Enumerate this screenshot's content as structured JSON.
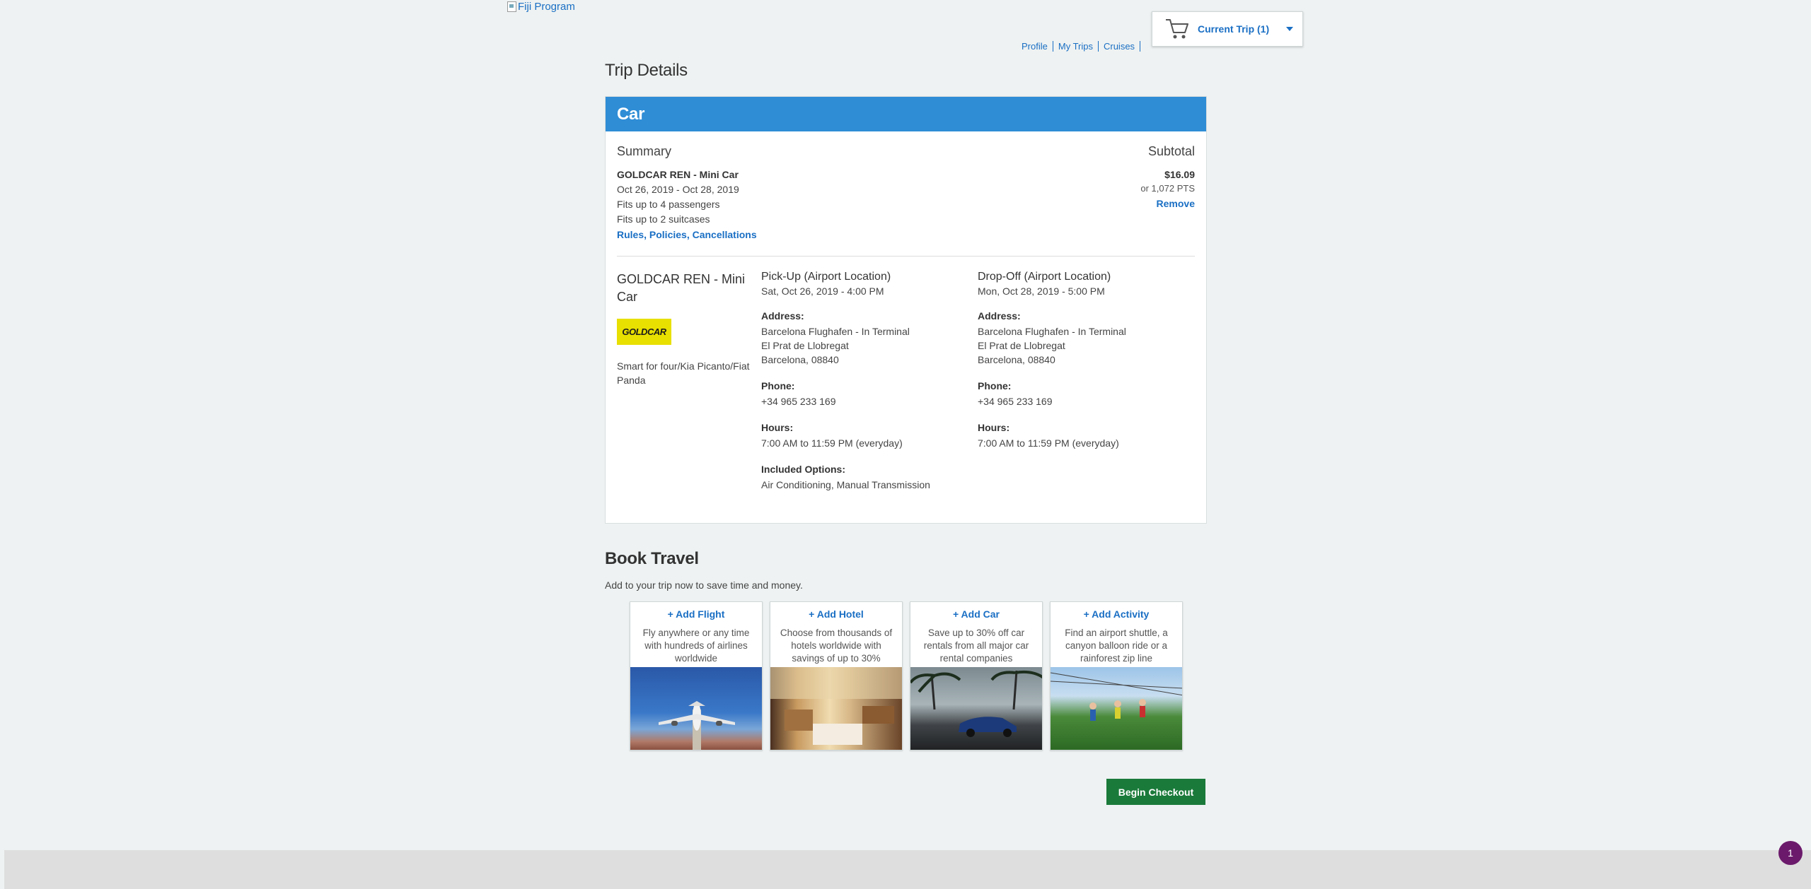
{
  "header": {
    "logo_alt": "Fiji Program",
    "nav": [
      "Profile",
      "My Trips",
      "Cruises"
    ],
    "cart_label": "Current Trip (1)"
  },
  "page_title": "Trip Details",
  "car_card": {
    "heading": "Car",
    "summary_title": "Summary",
    "subtotal_title": "Subtotal",
    "car_name": "GOLDCAR REN - Mini Car",
    "dates": "Oct 26, 2019 - Oct 28, 2019",
    "passengers": "Fits up to 4 passengers",
    "suitcases": "Fits up to 2 suitcases",
    "rules_link": "Rules, Policies, Cancellations",
    "price": "$16.09",
    "points": "or 1,072 PTS",
    "remove_label": "Remove",
    "vehicle_name": "GOLDCAR REN - Mini Car",
    "vendor_logo": "GOLDCAR",
    "vehicle_models": "Smart for four/Kia Picanto/Fiat Panda",
    "pickup": {
      "title": "Pick-Up (Airport Location)",
      "datetime": "Sat, Oct 26, 2019 - 4:00 PM",
      "address_label": "Address:",
      "address": [
        "Barcelona Flughafen - In Terminal",
        "El Prat de Llobregat",
        "Barcelona, 08840"
      ],
      "phone_label": "Phone:",
      "phone": "+34 965 233 169",
      "hours_label": "Hours:",
      "hours": "7:00 AM to 11:59 PM (everyday)",
      "options_label": "Included Options:",
      "options": "Air Conditioning, Manual Transmission"
    },
    "dropoff": {
      "title": "Drop-Off (Airport Location)",
      "datetime": "Mon, Oct 28, 2019 - 5:00 PM",
      "address_label": "Address:",
      "address": [
        "Barcelona Flughafen - In Terminal",
        "El Prat de Llobregat",
        "Barcelona, 08840"
      ],
      "phone_label": "Phone:",
      "phone": "+34 965 233 169",
      "hours_label": "Hours:",
      "hours": "7:00 AM to 11:59 PM (everyday)"
    }
  },
  "book_travel": {
    "title": "Book Travel",
    "subtitle": "Add to your trip now to save time and money.",
    "tiles": [
      {
        "title": "+ Add Flight",
        "desc": "Fly anywhere or any time with hundreds of airlines worldwide"
      },
      {
        "title": "+ Add Hotel",
        "desc": "Choose from thousands of hotels worldwide with savings of up to 30%"
      },
      {
        "title": "+ Add Car",
        "desc": "Save up to 30% off car rentals from all major car rental companies"
      },
      {
        "title": "+ Add Activity",
        "desc": "Find an airport shuttle, a canyon balloon ride or a rainforest zip line"
      }
    ]
  },
  "checkout_label": "Begin Checkout",
  "notification_count": "1",
  "colors": {
    "card_header": "#2f8dd6",
    "link": "#1a6fc4",
    "checkout": "#1a7a3a",
    "badge": "#6b1a6b",
    "vendor_logo_bg": "#e8e000"
  }
}
